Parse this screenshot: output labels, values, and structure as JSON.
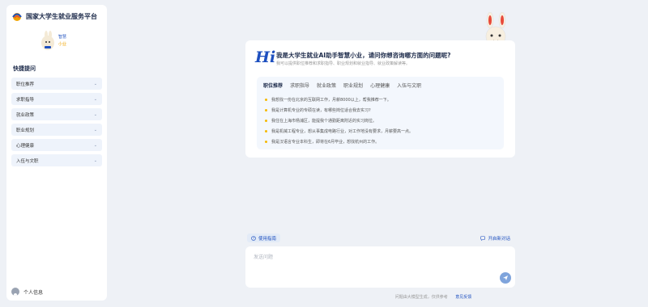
{
  "sidebar": {
    "brand_title": "国家大学生就业服务平台",
    "mascot_caption_1": "智慧",
    "mascot_caption_2": "小业",
    "section_title": "快捷提问",
    "items": [
      {
        "label": "职位推荐",
        "icon": "chevron-double-down-icon"
      },
      {
        "label": "求职指导",
        "icon": "chevron-double-down-icon"
      },
      {
        "label": "就业政策",
        "icon": "chevron-double-down-icon"
      },
      {
        "label": "职业规划",
        "icon": "chevron-double-down-icon"
      },
      {
        "label": "心理健康",
        "icon": "chevron-double-down-icon"
      },
      {
        "label": "入伍与文职",
        "icon": "chevron-double-down-icon"
      }
    ],
    "profile_label": "个人信息"
  },
  "welcome": {
    "logo_text": "Hi",
    "title": "我是大学生就业AI助手智慧小业，请问你想咨询哪方面的问题呢?",
    "subtitle": "我可以提供职位推荐和求职指导、职业规划和就业指导、就业政策解读等。"
  },
  "topics": {
    "tabs": [
      "职位推荐",
      "求职指导",
      "就业政策",
      "职业规划",
      "心理健康",
      "入伍与文职"
    ],
    "active_tab": "职位推荐",
    "questions": [
      "我想找一份在北京的互联网工作，月薪8000以上，帮我推荐一下。",
      "我是计算机专业的专硕在读，有哪些岗位适合我去实习?",
      "我住在上海市杨浦区，能提我个通勤距离附近的实习岗位。",
      "我是机械工程专业，想从事集成电路行业，对工作地没有要求，月薪要高一点。",
      "我是汉语言专业本科生，即将在6月毕业，想找杭州的工作。"
    ]
  },
  "composer": {
    "guide_label": "使用指南",
    "new_chat_label": "开启新对话",
    "placeholder": "发送问题",
    "value": ""
  },
  "footer": {
    "disclaimer": "问题由大模型生成，仅供参考",
    "feedback_label": "意见反馈"
  },
  "colors": {
    "accent": "#1d4fbf",
    "question_dot": "#f5b800",
    "send_button": "#7fa4dc"
  }
}
